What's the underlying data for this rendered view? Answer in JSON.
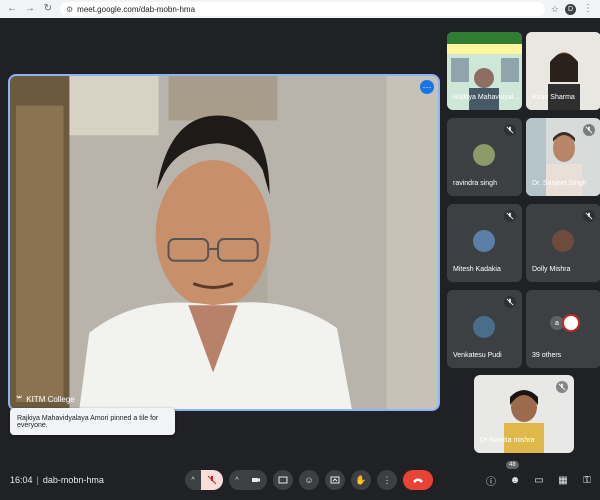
{
  "browser": {
    "url": "meet.google.com/dab-mobn-hma",
    "profile_initial": "D"
  },
  "main": {
    "name": "KITM College",
    "more_icon": "more-vert-icon"
  },
  "toast": {
    "text": "Rajkiya Mahavidyalaya Amori pinned a tile for everyone."
  },
  "tiles": [
    {
      "name": "Rajkiya Mahavidyalaya Amori",
      "display": "Rajkiya Mahavidyal...",
      "muted": false
    },
    {
      "name": "Kiran Sharma",
      "display": "Kiran Sharma",
      "muted": false
    },
    {
      "name": "ravindra singh",
      "display": "ravindra singh",
      "muted": true
    },
    {
      "name": "Dr. Sanjeet Singh",
      "display": "Dr. Sanjeet Singh",
      "muted": true
    },
    {
      "name": "Mitesh Kadakia",
      "display": "Mitesh Kadakia",
      "muted": true
    },
    {
      "name": "Dolly Mishra",
      "display": "Dolly Mishra",
      "muted": true
    },
    {
      "name": "Venkatesu Pudi",
      "display": "Venkatesu Pudi",
      "muted": true
    },
    {
      "name": "39 others",
      "display": "39 others",
      "muted": false
    },
    {
      "name": "Dr Namita mishra",
      "display": "Dr Namita mishra",
      "muted": true
    }
  ],
  "bottom": {
    "time": "16:04",
    "separator": "|",
    "meeting_code": "dab-mobn-hma",
    "participant_count": "48"
  },
  "colors": {
    "background": "#202124",
    "tile": "#3c4043",
    "accent": "#8ab4f8",
    "leave": "#ea4335",
    "mic_muted_bg": "#f9dedc"
  }
}
